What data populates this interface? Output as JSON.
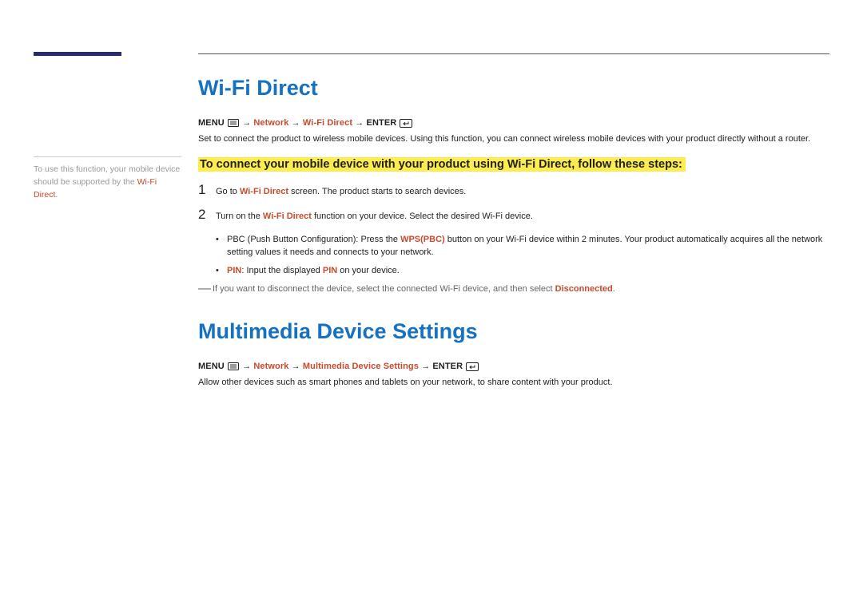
{
  "sideNote": {
    "pre": "To use this function, your mobile device should be supported by the ",
    "emph": "Wi-Fi Direct",
    "post": "."
  },
  "section1": {
    "heading": "Wi-Fi Direct",
    "path": {
      "menu": "MENU",
      "arrow1": " → ",
      "p1": "Network",
      "arrow2": " → ",
      "p2": "Wi-Fi Direct",
      "arrow3": " → ",
      "enter": "ENTER"
    },
    "intro": "Set to connect the product to wireless mobile devices. Using this function, you can connect wireless mobile devices with your product directly without a router.",
    "highlight": "To connect your mobile device with your product using Wi-Fi Direct, follow these steps:",
    "step1": {
      "num": "1",
      "pre": "Go to ",
      "emph": "Wi-Fi Direct",
      "post": " screen. The product starts to search devices."
    },
    "step2": {
      "num": "2",
      "pre": "Turn on the ",
      "emph": "Wi-Fi Direct",
      "post": " function on your device. Select the desired Wi-Fi device."
    },
    "bullet1": {
      "dot": "•",
      "pre": "PBC (Push Button Configuration): Press the ",
      "emph": "WPS(PBC)",
      "post": " button on your Wi-Fi device within 2 minutes. Your product automatically acquires all the network setting values it needs and connects to your network."
    },
    "bullet2": {
      "dot": "•",
      "emph1": "PIN",
      "mid": ": Input the displayed ",
      "emph2": "PIN",
      "post": " on your device."
    },
    "note": {
      "dash": "―",
      "pre": "If you want to disconnect the device, select the connected Wi-Fi device, and then select ",
      "emph": "Disconnected",
      "post": "."
    }
  },
  "section2": {
    "heading": "Multimedia Device Settings",
    "path": {
      "menu": "MENU",
      "arrow1": " → ",
      "p1": "Network",
      "arrow2": " → ",
      "p2": "Multimedia Device Settings",
      "arrow3": " → ",
      "enter": "ENTER"
    },
    "body": "Allow other devices such as smart phones and tablets on your network, to share content with your product."
  }
}
